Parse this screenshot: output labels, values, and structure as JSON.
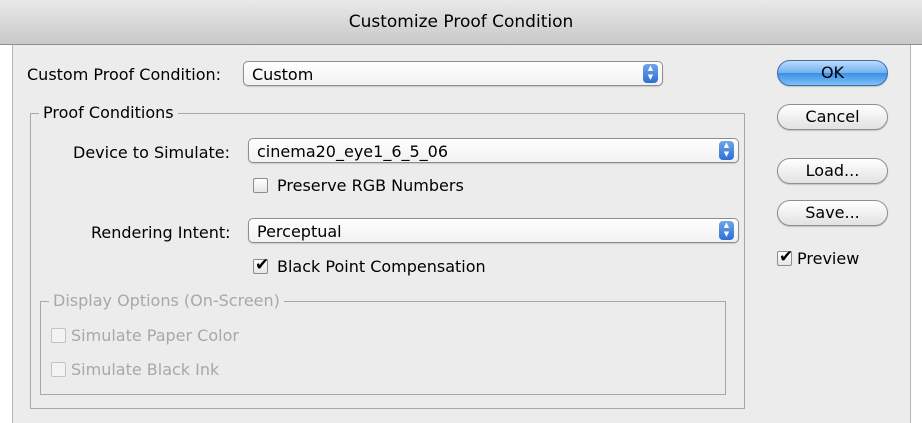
{
  "window": {
    "title": "Customize Proof Condition"
  },
  "custom_proof": {
    "label": "Custom Proof Condition:",
    "value": "Custom"
  },
  "proof_conditions": {
    "title": "Proof Conditions",
    "device_label": "Device to Simulate:",
    "device_value": "cinema20_eye1_6_5_06",
    "preserve_rgb": {
      "label": "Preserve RGB Numbers",
      "checked": false
    },
    "intent_label": "Rendering Intent:",
    "intent_value": "Perceptual",
    "black_point": {
      "label": "Black Point Compensation",
      "checked": true
    }
  },
  "display_options": {
    "title": "Display Options (On-Screen)",
    "paper_color": {
      "label": "Simulate Paper Color",
      "checked": false,
      "enabled": false
    },
    "black_ink": {
      "label": "Simulate Black Ink",
      "checked": false,
      "enabled": false
    }
  },
  "buttons": {
    "ok": "OK",
    "cancel": "Cancel",
    "load": "Load...",
    "save": "Save..."
  },
  "preview": {
    "label": "Preview",
    "checked": true
  },
  "colors": {
    "accent": "#3b8fe8",
    "dialog_bg": "#ececec",
    "disabled_text": "#a8a8a8"
  },
  "icons": {
    "popup_arrows": "popup-arrows-icon",
    "check": "checkmark-icon"
  }
}
